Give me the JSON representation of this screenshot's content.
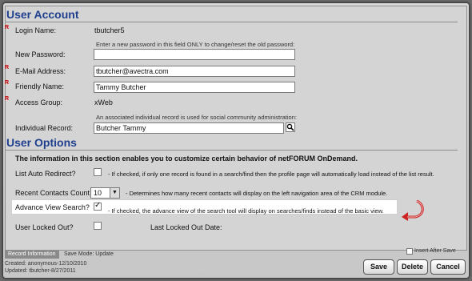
{
  "user_account": {
    "title": "User Account",
    "login_name_label": "Login Name:",
    "login_name_value": "tbutcher5",
    "password_hint": "Enter a new password in this field ONLY to change/reset the old password:",
    "new_password_label": "New Password:",
    "new_password_value": "",
    "email_label": "E-Mail Address:",
    "email_value": "tbutcher@avectra.com",
    "friendly_name_label": "Friendly Name:",
    "friendly_name_value": "Tammy Butcher",
    "access_group_label": "Access Group:",
    "access_group_value": "xWeb",
    "individual_hint": "An associated individual record is used for social community administration:",
    "individual_record_label": "Individual Record:",
    "individual_record_value": "Butcher Tammy",
    "required_marker": "R"
  },
  "user_options": {
    "title": "User Options",
    "intro": "The information in this section enables you to customize certain behavior of netFORUM OnDemand.",
    "list_auto_redirect_label": "List Auto Redirect?",
    "list_auto_redirect_checked": false,
    "list_auto_redirect_desc": "- If checked, if only one record is found in a search/find then the profile page will automatically load instead of the list result.",
    "recent_contacts_label": "Recent Contacts Count",
    "recent_contacts_value": "10",
    "recent_contacts_desc": "- Determines how many recent contacts will display on the left navigation area of the CRM module.",
    "advance_view_label": "Advance View Search?",
    "advance_view_checked": true,
    "advance_view_desc": "- If checked, the advance view of the search tool will display on searches/finds instead of the basic view.",
    "locked_out_label": "User Locked Out?",
    "locked_out_checked": false,
    "last_locked_label": "Last Locked Out Date:"
  },
  "footer": {
    "record_info_tab": "Record Information",
    "save_mode": "Save Mode: Update",
    "created": "Created: anonymous-12/10/2010",
    "updated": "Updated: tbutcher-8/27/2011",
    "insert_after_save": "Insert After Save",
    "save_label": "Save",
    "delete_label": "Delete",
    "cancel_label": "Cancel"
  },
  "colors": {
    "section_title": "#1f3f8e",
    "required": "#cc0000",
    "arrow": "#cc2222"
  },
  "icons": {
    "lookup": "magnifier-icon",
    "dropdown": "chevron-down-icon",
    "annotation": "curved-arrow-icon"
  }
}
